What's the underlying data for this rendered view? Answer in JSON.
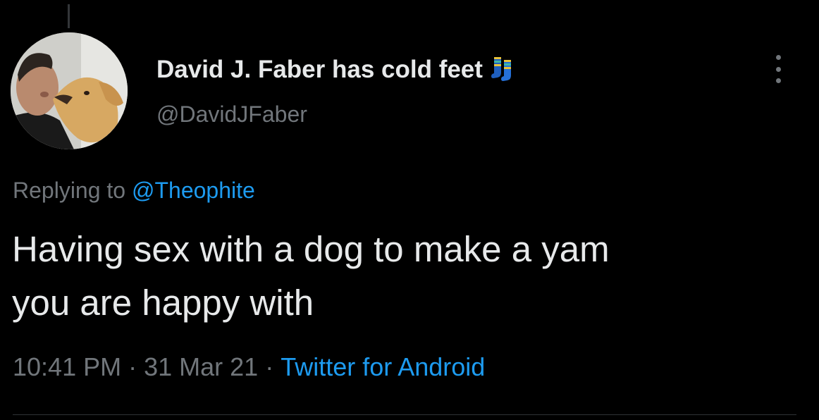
{
  "tweet": {
    "display_name": "David J. Faber has cold feet",
    "name_emoji": "socks-icon",
    "handle": "@DavidJFaber",
    "replying_to_prefix": "Replying to",
    "replying_to_handle": "@Theophite",
    "text_line1": "Having sex with a dog to make a yam",
    "text_line2": "you are happy with",
    "time": "10:41 PM",
    "separator": "·",
    "date": "31 Mar 21",
    "source": "Twitter for Android"
  },
  "colors": {
    "background": "#000000",
    "primary_text": "#e7e9ea",
    "secondary_text": "#71767b",
    "accent": "#1d9bf0"
  }
}
